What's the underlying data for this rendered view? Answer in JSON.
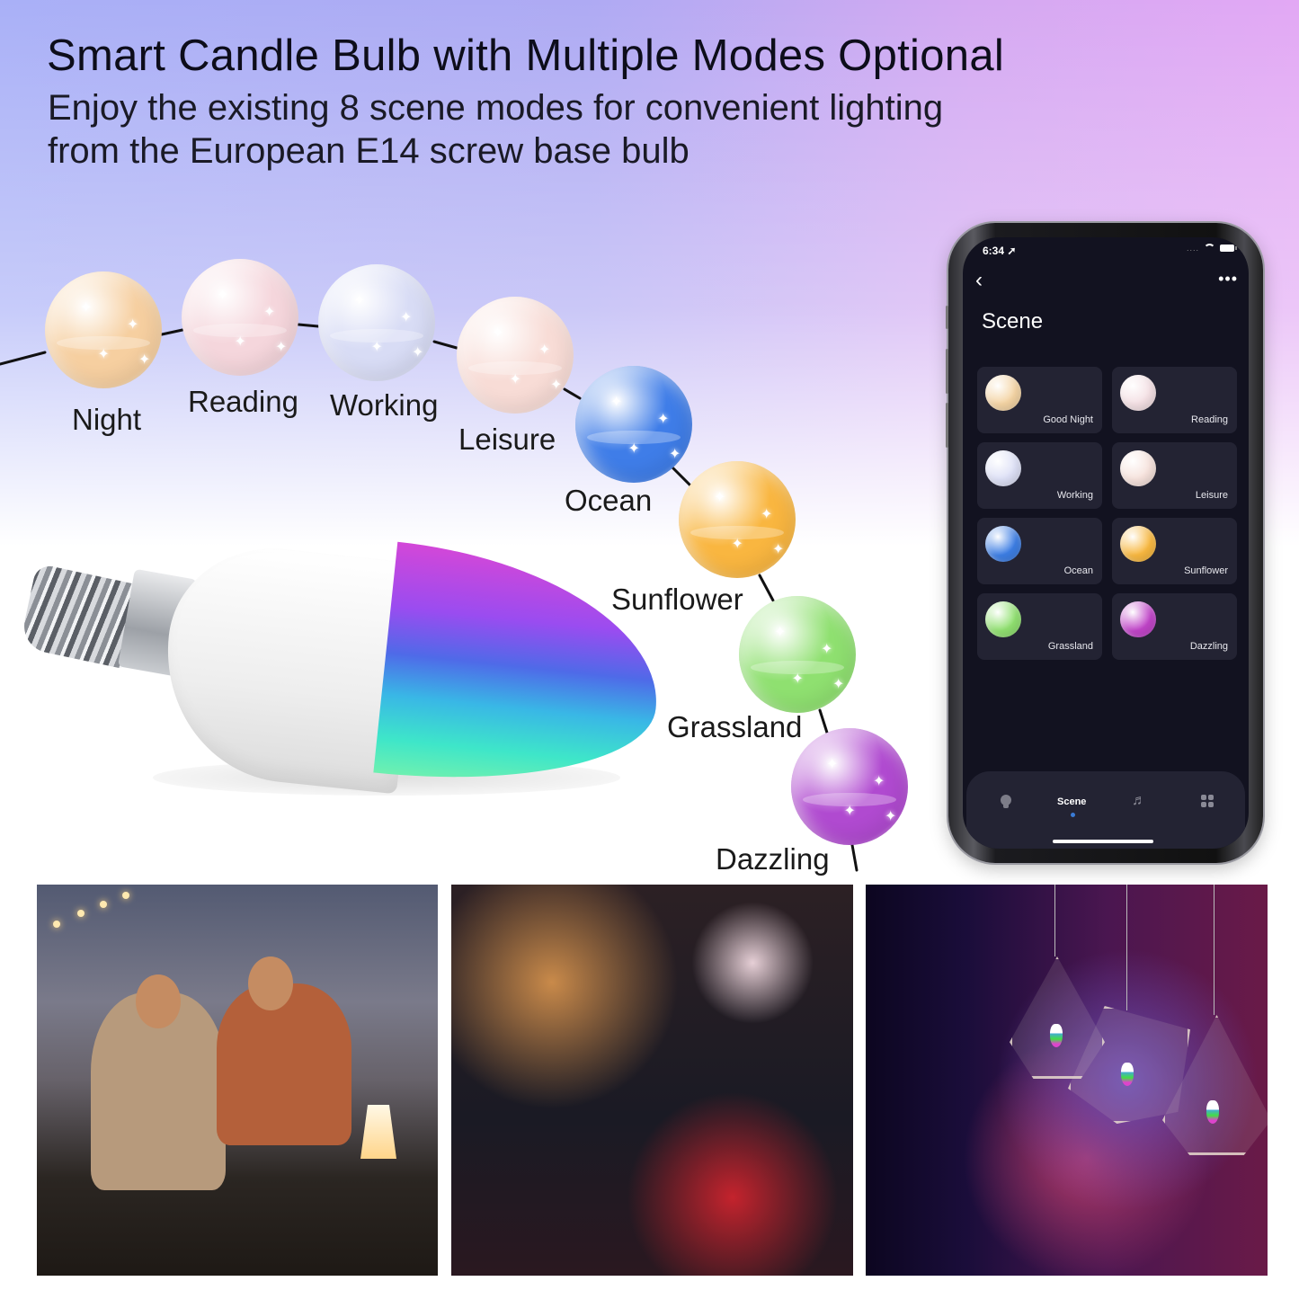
{
  "header": {
    "title": "Smart Candle Bulb with Multiple Modes Optional",
    "subtitle_lines": [
      "Enjoy the existing 8 scene modes for convenient lighting",
      "from the European E14 screw base bulb"
    ]
  },
  "scene_orbs": [
    {
      "label": "Night",
      "color": "#f6cfa0"
    },
    {
      "label": "Reading",
      "color": "#f5d6dc"
    },
    {
      "label": "Working",
      "color": "#d8dcf5"
    },
    {
      "label": "Leisure",
      "color": "#f8dcd6"
    },
    {
      "label": "Ocean",
      "color": "#3f7de8"
    },
    {
      "label": "Sunflower",
      "color": "#f9b640"
    },
    {
      "label": "Grassland",
      "color": "#8fe070"
    },
    {
      "label": "Dazzling",
      "color": "#b04ad0"
    }
  ],
  "phone": {
    "status": {
      "time": "6:34",
      "location_icon": "location-arrow-icon",
      "signal_dots": "....",
      "wifi_icon": "wifi-icon",
      "battery_icon": "battery-icon"
    },
    "nav": {
      "back_icon": "‹",
      "more_icon": "•••"
    },
    "page_title": "Scene",
    "scenes": [
      {
        "label": "Good Night",
        "color": "#f4d4a4"
      },
      {
        "label": "Reading",
        "color": "#f4e0e4"
      },
      {
        "label": "Working",
        "color": "#dde0f6"
      },
      {
        "label": "Leisure",
        "color": "#f6e2dc"
      },
      {
        "label": "Ocean",
        "color": "#3d7ee4"
      },
      {
        "label": "Sunflower",
        "color": "#f8b840"
      },
      {
        "label": "Grassland",
        "color": "#90e070"
      },
      {
        "label": "Dazzling",
        "color": "#c044c8"
      }
    ],
    "tabbar": {
      "tabs": [
        {
          "name": "bulb",
          "icon": "bulb-icon",
          "label": ""
        },
        {
          "name": "scene",
          "icon": "",
          "label": "Scene",
          "active": true
        },
        {
          "name": "music",
          "icon": "music-note-icon",
          "label": "♬"
        },
        {
          "name": "grid",
          "icon": "grid-icon",
          "label": ""
        }
      ],
      "accent": "#3a7bd5"
    }
  },
  "photos": [
    {
      "name": "camping-scene",
      "description": "Two men at an outdoor camp at dusk with a glowing lamp"
    },
    {
      "name": "bar-bokeh-scene",
      "description": "Rain-covered window with colorful bokeh and bottles"
    },
    {
      "name": "pendant-lights-scene",
      "description": "Geometric wire pendant lamps with RGB candle bulbs"
    }
  ]
}
